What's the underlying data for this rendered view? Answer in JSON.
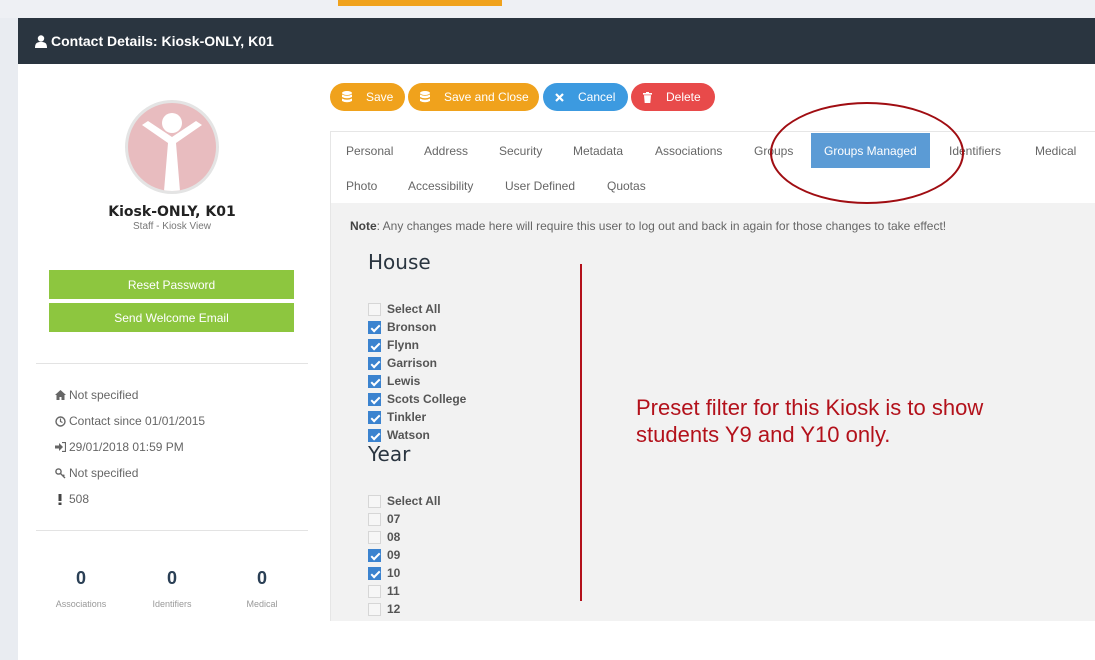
{
  "window_title": "Contact Details: Kiosk-ONLY, K01",
  "contact": {
    "name": "Kiosk-ONLY, K01",
    "role": "Staff - Kiosk View"
  },
  "left_buttons": {
    "reset_password": "Reset Password",
    "send_welcome": "Send Welcome Email"
  },
  "info": [
    {
      "icon": "home-icon",
      "text": "Not specified"
    },
    {
      "icon": "clock-icon",
      "text": "Contact since 01/01/2015"
    },
    {
      "icon": "sign-in-icon",
      "text": "29/01/2018 01:59 PM"
    },
    {
      "icon": "key-icon",
      "text": "Not specified"
    },
    {
      "icon": "exclamation-icon",
      "text": "508"
    }
  ],
  "stats": [
    {
      "value": "0",
      "label": "Associations"
    },
    {
      "value": "0",
      "label": "Identifiers"
    },
    {
      "value": "0",
      "label": "Medical"
    }
  ],
  "actions": {
    "save": "Save",
    "save_close": "Save and Close",
    "cancel": "Cancel",
    "delete": "Delete",
    "colors": {
      "save": "#f0a21c",
      "cancel": "#3c9ae0",
      "delete": "#e84a4a"
    }
  },
  "tabs_row1": [
    "Personal",
    "Address",
    "Security",
    "Metadata",
    "Associations",
    "Groups",
    "Groups Managed",
    "Identifiers",
    "Medical"
  ],
  "tabs_row2": [
    "Photo",
    "Accessibility",
    "User Defined",
    "Quotas"
  ],
  "active_tab": "Groups Managed",
  "note": {
    "label": "Note",
    "text": ": Any changes made here will require this user to log out and back in again for those changes to take effect!"
  },
  "house": {
    "heading": "House",
    "items": [
      {
        "label": "Select All",
        "checked": false
      },
      {
        "label": "Bronson",
        "checked": true
      },
      {
        "label": "Flynn",
        "checked": true
      },
      {
        "label": "Garrison",
        "checked": true
      },
      {
        "label": "Lewis",
        "checked": true
      },
      {
        "label": "Scots College",
        "checked": true
      },
      {
        "label": "Tinkler",
        "checked": true
      },
      {
        "label": "Watson",
        "checked": true
      }
    ]
  },
  "year": {
    "heading": "Year",
    "items": [
      {
        "label": "Select All",
        "checked": false
      },
      {
        "label": "07",
        "checked": false
      },
      {
        "label": "08",
        "checked": false
      },
      {
        "label": "09",
        "checked": true
      },
      {
        "label": "10",
        "checked": true
      },
      {
        "label": "11",
        "checked": false
      },
      {
        "label": "12",
        "checked": false
      }
    ]
  },
  "annotation": {
    "line1": "Preset filter for this Kiosk is to show",
    "line2": "students Y9 and Y10 only.",
    "color": "#b3111b"
  }
}
